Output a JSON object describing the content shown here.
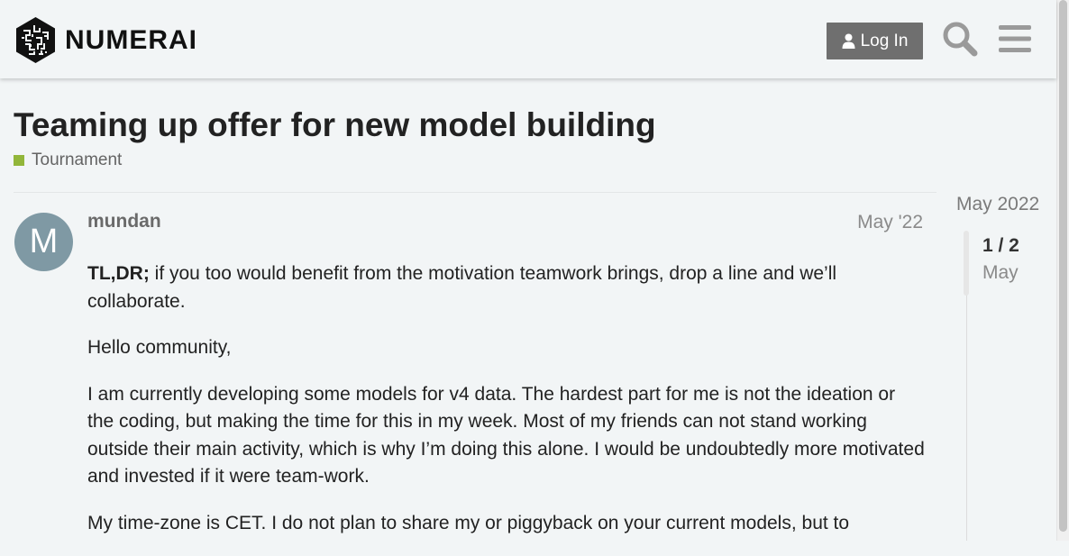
{
  "header": {
    "logo_text": "NUMERAI",
    "login_label": "Log In",
    "search_icon": "search-icon",
    "menu_icon": "hamburger-menu-icon"
  },
  "topic": {
    "title": "Teaming up offer for new model building",
    "category": "Tournament",
    "category_color": "#92b63a"
  },
  "post": {
    "avatar_letter": "M",
    "avatar_color": "#7f99a4",
    "username": "mundan",
    "date": "May '22",
    "tldr_label": "TL,DR;",
    "tldr_text": " if you too would benefit from the motivation teamwork brings, drop a line and we’ll collaborate.",
    "p1": "Hello community,",
    "p2": "I am currently developing some models for v4 data. The hardest part for me is not the ideation or the coding, but making the time for this in my week. Most of my friends can not stand working outside their main activity, which is why I’m doing this alone. I would be undoubtedly more motivated and invested if it were team-work.",
    "p3": "My time-zone is CET. I do not plan to share my or piggyback on your current models, but to"
  },
  "timeline": {
    "start_label": "May 2022",
    "progress": "1 / 2",
    "date": "May"
  }
}
